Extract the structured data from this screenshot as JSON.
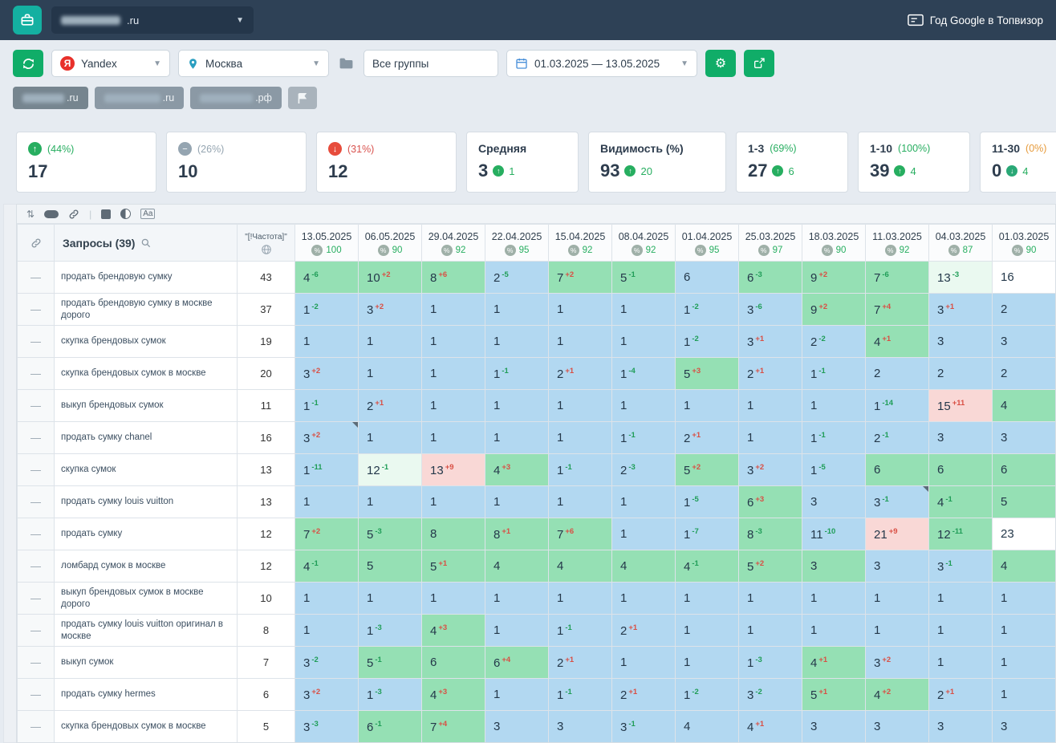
{
  "topbar": {
    "project_suffix": ".ru",
    "promo_label": "Год Google в Топвизор"
  },
  "toolbar": {
    "search_engine": "Yandex",
    "region": "Москва",
    "groups_value": "Все группы",
    "date_range": "01.03.2025 — 13.05.2025"
  },
  "competitors": [
    {
      "suffix": ".ru"
    },
    {
      "suffix": ".ru"
    },
    {
      "suffix": ".рф"
    }
  ],
  "cards": {
    "up": {
      "pct": "(44%)",
      "value": "17"
    },
    "stable": {
      "pct": "(26%)",
      "value": "10"
    },
    "down": {
      "pct": "(31%)",
      "value": "12"
    },
    "avg": {
      "label": "Средняя",
      "value": "3",
      "delta": "1"
    },
    "visibility": {
      "label": "Видимость (%)",
      "value": "93",
      "delta": "20"
    },
    "top3": {
      "label": "1-3",
      "pct": "(69%)",
      "value": "27",
      "delta": "6"
    },
    "top10": {
      "label": "1-10",
      "pct": "(100%)",
      "value": "39",
      "delta": "4"
    },
    "top30": {
      "label": "11-30",
      "pct": "(0%)",
      "value": "0",
      "delta": "4"
    }
  },
  "table": {
    "queries_header": "Запросы (39)",
    "frequency_header": "\"[!Частота]\"",
    "dates": [
      "13.05.2025",
      "06.05.2025",
      "29.04.2025",
      "22.04.2025",
      "15.04.2025",
      "08.04.2025",
      "01.04.2025",
      "25.03.2025",
      "18.03.2025",
      "11.03.2025",
      "04.03.2025",
      "01.03.2025"
    ],
    "date_pcts": [
      100,
      90,
      92,
      95,
      92,
      92,
      95,
      97,
      90,
      92,
      87,
      90
    ],
    "rows": [
      {
        "query": "продать брендовую сумку",
        "freq": 43,
        "values": [
          4,
          10,
          8,
          2,
          7,
          5,
          6,
          6,
          9,
          7,
          13,
          16
        ],
        "deltas": [
          "-6",
          "+2",
          "+6",
          "-5",
          "+2",
          "-1",
          null,
          "-3",
          "+2",
          "-6",
          "-3",
          null
        ],
        "colors": [
          "g",
          "g",
          "g",
          "b",
          "g",
          "g",
          "b",
          "g",
          "g",
          "g",
          "m",
          "w"
        ]
      },
      {
        "query": "продать брендовую сумку в москве дорого",
        "freq": 37,
        "values": [
          1,
          3,
          1,
          1,
          1,
          1,
          1,
          3,
          9,
          7,
          3,
          2
        ],
        "deltas": [
          "-2",
          "+2",
          null,
          null,
          null,
          null,
          "-2",
          "-6",
          "+2",
          "+4",
          "+1",
          null
        ],
        "colors": [
          "b",
          "b",
          "b",
          "b",
          "b",
          "b",
          "b",
          "b",
          "g",
          "g",
          "b",
          "b"
        ]
      },
      {
        "query": "скупка брендовых сумок",
        "freq": 19,
        "values": [
          1,
          1,
          1,
          1,
          1,
          1,
          1,
          3,
          2,
          4,
          3,
          3
        ],
        "deltas": [
          null,
          null,
          null,
          null,
          null,
          null,
          "-2",
          "+1",
          "-2",
          "+1",
          null,
          null
        ],
        "colors": [
          "b",
          "b",
          "b",
          "b",
          "b",
          "b",
          "b",
          "b",
          "b",
          "g",
          "b",
          "b"
        ]
      },
      {
        "query": "скупка брендовых сумок в москве",
        "freq": 20,
        "values": [
          3,
          1,
          1,
          1,
          2,
          1,
          5,
          2,
          1,
          2,
          2,
          2
        ],
        "deltas": [
          "+2",
          null,
          null,
          "-1",
          "+1",
          "-4",
          "+3",
          "+1",
          "-1",
          null,
          null,
          null
        ],
        "colors": [
          "b",
          "b",
          "b",
          "b",
          "b",
          "b",
          "g",
          "b",
          "b",
          "b",
          "b",
          "b"
        ]
      },
      {
        "query": "выкуп брендовых сумок",
        "freq": 11,
        "values": [
          1,
          2,
          1,
          1,
          1,
          1,
          1,
          1,
          1,
          1,
          15,
          4
        ],
        "deltas": [
          "-1",
          "+1",
          null,
          null,
          null,
          null,
          null,
          null,
          null,
          "-14",
          "+11",
          null
        ],
        "colors": [
          "b",
          "b",
          "b",
          "b",
          "b",
          "b",
          "b",
          "b",
          "b",
          "b",
          "p",
          "g"
        ]
      },
      {
        "query": "продать сумку chanel",
        "freq": 16,
        "values": [
          3,
          1,
          1,
          1,
          1,
          1,
          2,
          1,
          1,
          2,
          3,
          3
        ],
        "deltas": [
          "+2",
          null,
          null,
          null,
          null,
          "-1",
          "+1",
          null,
          "-1",
          "-1",
          null,
          null
        ],
        "colors": [
          "b",
          "b",
          "b",
          "b",
          "b",
          "b",
          "b",
          "b",
          "b",
          "b",
          "b",
          "b"
        ],
        "marker_cells": [
          0
        ]
      },
      {
        "query": "скупка сумок",
        "freq": 13,
        "values": [
          1,
          12,
          13,
          4,
          1,
          2,
          5,
          3,
          1,
          6,
          6,
          6
        ],
        "deltas": [
          "-11",
          "-1",
          "+9",
          "+3",
          "-1",
          "-3",
          "+2",
          "+2",
          "-5",
          null,
          null,
          null
        ],
        "colors": [
          "b",
          "m",
          "p",
          "g",
          "b",
          "b",
          "g",
          "b",
          "b",
          "g",
          "g",
          "g"
        ]
      },
      {
        "query": "продать сумку louis vuitton",
        "freq": 13,
        "values": [
          1,
          1,
          1,
          1,
          1,
          1,
          1,
          6,
          3,
          3,
          4,
          5
        ],
        "deltas": [
          null,
          null,
          null,
          null,
          null,
          null,
          "-5",
          "+3",
          null,
          "-1",
          "-1",
          null
        ],
        "colors": [
          "b",
          "b",
          "b",
          "b",
          "b",
          "b",
          "b",
          "g",
          "b",
          "b",
          "g",
          "g"
        ],
        "marker_cells": [
          9
        ]
      },
      {
        "query": "продать сумку",
        "freq": 12,
        "values": [
          7,
          5,
          8,
          8,
          7,
          1,
          1,
          8,
          11,
          21,
          12,
          23
        ],
        "deltas": [
          "+2",
          "-3",
          null,
          "+1",
          "+6",
          null,
          "-7",
          "-3",
          "-10",
          "+9",
          "-11",
          null
        ],
        "colors": [
          "g",
          "g",
          "g",
          "g",
          "g",
          "b",
          "b",
          "g",
          "b",
          "p",
          "g",
          "w"
        ]
      },
      {
        "query": "ломбард сумок в москве",
        "freq": 12,
        "values": [
          4,
          5,
          5,
          4,
          4,
          4,
          4,
          5,
          3,
          3,
          3,
          4
        ],
        "deltas": [
          "-1",
          null,
          "+1",
          null,
          null,
          null,
          "-1",
          "+2",
          null,
          null,
          "-1",
          null
        ],
        "colors": [
          "g",
          "g",
          "g",
          "g",
          "g",
          "g",
          "g",
          "g",
          "g",
          "b",
          "b",
          "g"
        ]
      },
      {
        "query": "выкуп брендовых сумок в москве дорого",
        "freq": 10,
        "values": [
          1,
          1,
          1,
          1,
          1,
          1,
          1,
          1,
          1,
          1,
          1,
          1
        ],
        "deltas": [
          null,
          null,
          null,
          null,
          null,
          null,
          null,
          null,
          null,
          null,
          null,
          null
        ],
        "colors": [
          "b",
          "b",
          "b",
          "b",
          "b",
          "b",
          "b",
          "b",
          "b",
          "b",
          "b",
          "b"
        ]
      },
      {
        "query": "продать сумку louis vuitton оригинал в москве",
        "freq": 8,
        "values": [
          1,
          1,
          4,
          1,
          1,
          2,
          1,
          1,
          1,
          1,
          1,
          1
        ],
        "deltas": [
          null,
          "-3",
          "+3",
          null,
          "-1",
          "+1",
          null,
          null,
          null,
          null,
          null,
          null
        ],
        "colors": [
          "b",
          "b",
          "g",
          "b",
          "b",
          "b",
          "b",
          "b",
          "b",
          "b",
          "b",
          "b"
        ]
      },
      {
        "query": "выкуп сумок",
        "freq": 7,
        "values": [
          3,
          5,
          6,
          6,
          2,
          1,
          1,
          1,
          4,
          3,
          1,
          1
        ],
        "deltas": [
          "-2",
          "-1",
          null,
          "+4",
          "+1",
          null,
          null,
          "-3",
          "+1",
          "+2",
          null,
          null
        ],
        "colors": [
          "b",
          "g",
          "g",
          "g",
          "b",
          "b",
          "b",
          "b",
          "g",
          "b",
          "b",
          "b"
        ]
      },
      {
        "query": "продать сумку hermes",
        "freq": 6,
        "values": [
          3,
          1,
          4,
          1,
          1,
          2,
          1,
          3,
          5,
          4,
          2,
          1
        ],
        "deltas": [
          "+2",
          "-3",
          "+3",
          null,
          "-1",
          "+1",
          "-2",
          "-2",
          "+1",
          "+2",
          "+1",
          null
        ],
        "colors": [
          "b",
          "b",
          "g",
          "b",
          "b",
          "b",
          "b",
          "b",
          "g",
          "g",
          "b",
          "b"
        ]
      },
      {
        "query": "скупка брендовых сумок в москве",
        "freq": 5,
        "values": [
          3,
          6,
          7,
          3,
          3,
          3,
          4,
          4,
          3,
          3,
          3,
          3
        ],
        "deltas": [
          "-3",
          "-1",
          "+4",
          null,
          null,
          "-1",
          null,
          "+1",
          null,
          null,
          null,
          null
        ],
        "colors": [
          "b",
          "g",
          "g",
          "b",
          "b",
          "b",
          "b",
          "b",
          "b",
          "b",
          "b",
          "b"
        ]
      }
    ]
  },
  "colors": {
    "cell_blue": "#b2d8f1",
    "cell_green": "#95e0b4",
    "cell_mint": "#eaf9f0",
    "cell_pink": "#f9d8d6",
    "delta_worse": "#d94f44",
    "delta_better": "#1f9d57",
    "accent_green": "#10ad68",
    "topbar_bg": "#2e4156",
    "logo_teal": "#14b0a1"
  }
}
